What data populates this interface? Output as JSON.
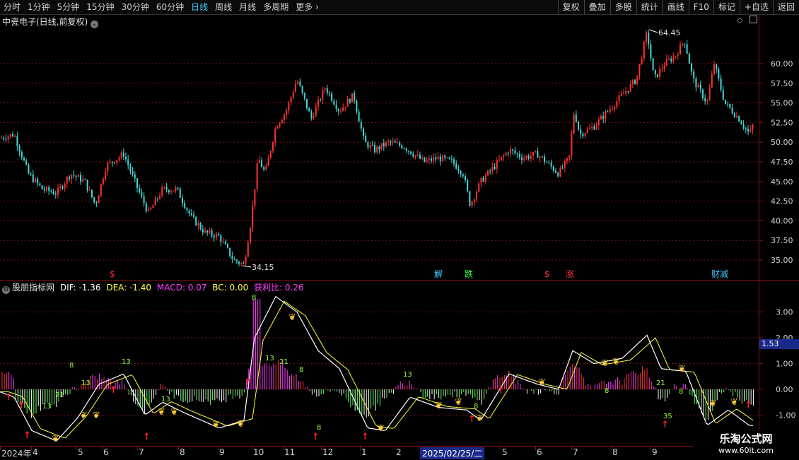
{
  "topbar": {
    "periods": [
      "分时",
      "1分钟",
      "5分钟",
      "15分钟",
      "30分钟",
      "60分钟",
      "日线",
      "周线",
      "月线",
      "多周期",
      "更多"
    ],
    "active_period": "日线",
    "buttons": [
      "复权",
      "叠加",
      "多股",
      "统计",
      "画线",
      "F10",
      "标记",
      "+自选",
      "返回"
    ]
  },
  "price_panel": {
    "title": "中瓷电子(日线,前复权)",
    "y_ticks": [
      "60.00",
      "57.50",
      "55.00",
      "52.50",
      "50.00",
      "47.50",
      "45.00",
      "42.50",
      "40.00",
      "37.50",
      "35.00"
    ],
    "high_label": "64.45",
    "low_label": "34.15",
    "signals": [
      {
        "text": "$",
        "color": "#ff3030"
      },
      {
        "text": "解",
        "color": "#40c8ff"
      },
      {
        "text": "跌",
        "color": "#40ff40"
      },
      {
        "text": "$",
        "color": "#ff3030"
      },
      {
        "text": "涨",
        "color": "#ff3030"
      },
      {
        "text": "财减",
        "color": "#40c8ff"
      }
    ]
  },
  "macd_panel": {
    "name": "股朋指标网",
    "dif_label": "DIF: -1.36",
    "dea_label": "DEA: -1.40",
    "macd_label": "MACD: 0.07",
    "bc_label": "BC: 0.00",
    "ratio_label": "获利比: 0.26",
    "y_ticks": [
      "3.00",
      "2.00",
      "1.00",
      "0.00",
      "-1.00"
    ],
    "current_value": "1.53"
  },
  "xaxis": {
    "labels": [
      "2024年",
      "4",
      "5",
      "6",
      "7",
      "8",
      "9",
      "10",
      "11",
      "12",
      "1",
      "2",
      "2025/02/25/二",
      "5",
      "6",
      "7",
      "8",
      "9"
    ]
  },
  "watermark": {
    "title": "乐淘公式网",
    "url": "www.60lt.com"
  },
  "colors": {
    "up": "#ff3232",
    "down": "#40d8d8",
    "grid": "#8a1010",
    "dif": "#ffffff",
    "dea": "#ffff40"
  }
}
